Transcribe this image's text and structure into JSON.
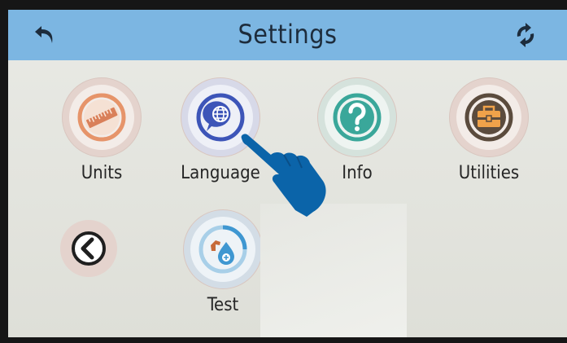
{
  "header": {
    "title": "Settings",
    "back_icon": "back-arrow-icon",
    "refresh_icon": "refresh-icon",
    "color": "#7cb6e2"
  },
  "tiles": [
    {
      "label": "Units",
      "icon": "ruler-icon",
      "accent": "#e6946a"
    },
    {
      "label": "Language",
      "icon": "globe-chat-icon",
      "accent": "#3d55b8"
    },
    {
      "label": "Info",
      "icon": "question-icon",
      "accent": "#3aa79a"
    },
    {
      "label": "Utilities",
      "icon": "toolbox-icon",
      "accent": "#5b4b3d"
    },
    {
      "label": "Test",
      "icon": "drop-test-icon",
      "accent": "#3f97d1"
    }
  ],
  "prev_page": {
    "icon": "chevron-left-icon"
  },
  "pointer": {
    "icon": "pointing-hand-icon",
    "color": "#0b64a9"
  }
}
